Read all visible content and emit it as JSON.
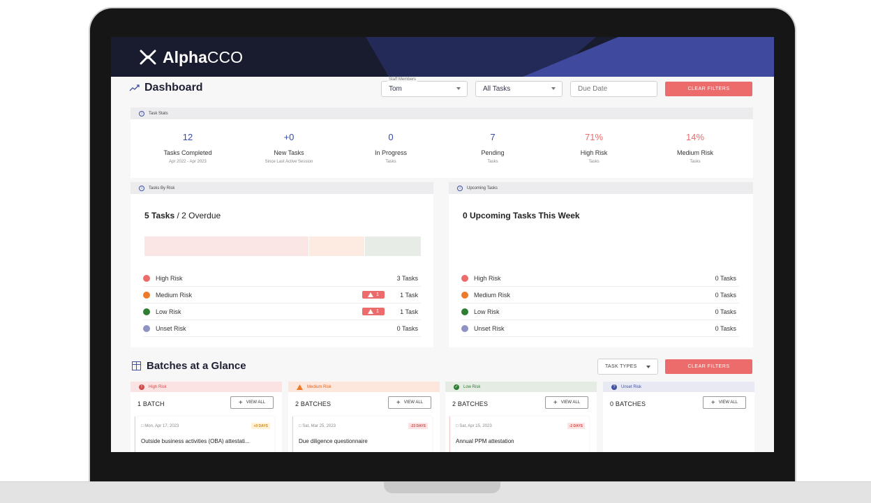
{
  "app": {
    "logo_bold": "Alpha",
    "logo_light": "CCO"
  },
  "dashboard": {
    "title": "Dashboard"
  },
  "filters": {
    "staff_label": "Staff Members",
    "staff_value": "Tom",
    "tasks_value": "All Tasks",
    "due_placeholder": "Due Date",
    "clear_label": "CLEAR FILTERS"
  },
  "task_stats": {
    "header": "Task Stats",
    "items": [
      {
        "value": "12",
        "label": "Tasks Completed",
        "sub": "Apr 2022 - Apr 2023",
        "color": "#3647a8"
      },
      {
        "value": "+0",
        "label": "New Tasks",
        "sub": "Since Last Active Session",
        "color": "#3647a8"
      },
      {
        "value": "0",
        "label": "In Progress",
        "sub": "Tasks",
        "color": "#3647a8"
      },
      {
        "value": "7",
        "label": "Pending",
        "sub": "Tasks",
        "color": "#3647a8"
      },
      {
        "value": "71%",
        "label": "High Risk",
        "sub": "Tasks",
        "color": "#ec6c6c"
      },
      {
        "value": "14%",
        "label": "Medium Risk",
        "sub": "Tasks",
        "color": "#ec6c6c"
      }
    ]
  },
  "tasks_by_risk": {
    "header": "Tasks By Risk",
    "title_bold": "5 Tasks",
    "title_rest": " / 2 Overdue",
    "rows": [
      {
        "label": "High Risk",
        "count": "3 Tasks",
        "warn": ""
      },
      {
        "label": "Medium Risk",
        "count": "1 Task",
        "warn": "1"
      },
      {
        "label": "Low Risk",
        "count": "1 Task",
        "warn": "1"
      },
      {
        "label": "Unset Risk",
        "count": "0 Tasks",
        "warn": ""
      }
    ]
  },
  "upcoming": {
    "header": "Upcoming Tasks",
    "title": "0 Upcoming Tasks This Week",
    "rows": [
      {
        "label": "High Risk",
        "count": "0 Tasks"
      },
      {
        "label": "Medium Risk",
        "count": "0 Tasks"
      },
      {
        "label": "Low Risk",
        "count": "0 Tasks"
      },
      {
        "label": "Unset Risk",
        "count": "0 Tasks"
      }
    ]
  },
  "risk_colors": {
    "high": "#ec6c6c",
    "medium": "#ee7a2b",
    "low": "#2e7d32",
    "unset": "#8e93c4"
  },
  "batches": {
    "title": "Batches at a Glance",
    "task_types_label": "TASK TYPES",
    "clear_label": "CLEAR FILTERS",
    "view_all_label": "VIEW ALL",
    "columns": [
      {
        "header": "High Risk",
        "count": "1 BATCH",
        "task": {
          "date": "Mon, Apr 17, 2023",
          "tag": "+0 DAYS",
          "name": "Outside business activities (OBA) attestati..."
        }
      },
      {
        "header": "Medium Risk",
        "count": "2 BATCHES",
        "task": {
          "date": "Sat, Mar 25, 2023",
          "tag": "-23 DAYS",
          "name": "Due diligence questionnaire"
        }
      },
      {
        "header": "Low Risk",
        "count": "2 BATCHES",
        "task": {
          "date": "Sat, Apr 15, 2023",
          "tag": "-2 DAYS",
          "name": "Annual PPM attestation"
        }
      },
      {
        "header": "Unset Risk",
        "count": "0 BATCHES"
      }
    ]
  }
}
